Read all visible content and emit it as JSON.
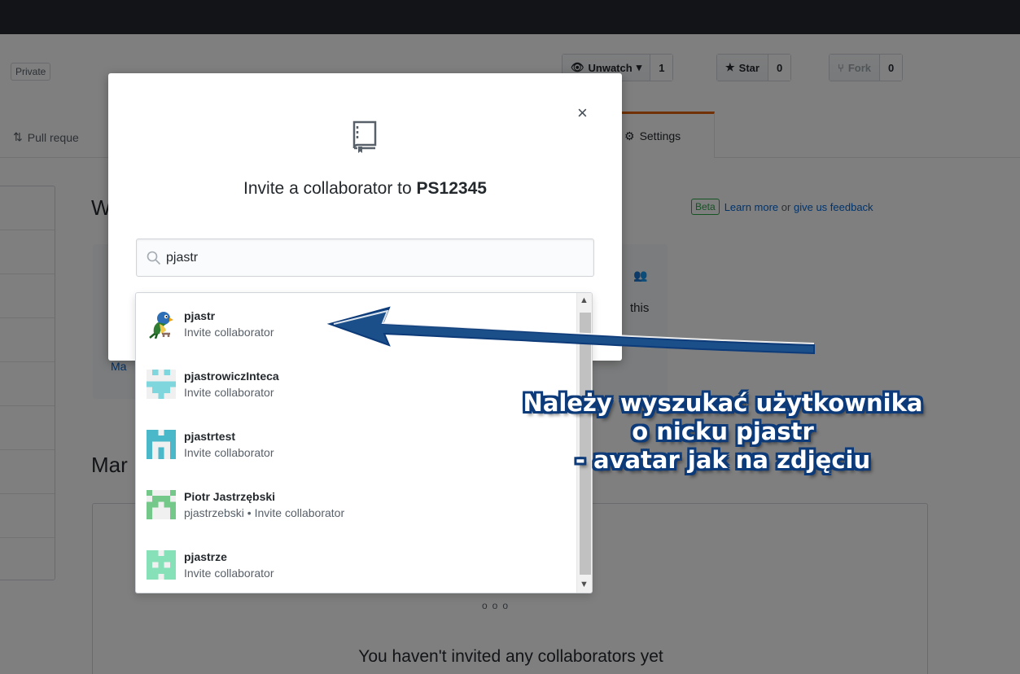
{
  "repo": {
    "private_label": "Private",
    "unwatch_label": "Unwatch",
    "unwatch_count": "1",
    "star_label": "Star",
    "star_count": "0",
    "fork_label": "Fork",
    "fork_count": "0"
  },
  "tabs": {
    "pull_requests": "Pull reque",
    "settings": "Settings"
  },
  "page": {
    "heading_w": "W",
    "heading_m": "Mar",
    "beta_tag": "Beta",
    "learn_more": "Learn more",
    "or_text": "or",
    "feedback": "give us feedback",
    "this_text": "this",
    "ma_link": "Ma",
    "no_collaborators": "You haven't invited any collaborators yet"
  },
  "modal": {
    "title_prefix": "Invite a collaborator to",
    "repo_name": "PS12345",
    "close_symbol": "×",
    "search_value": "pjastr"
  },
  "results": [
    {
      "name": "pjastr",
      "sub": "Invite collaborator"
    },
    {
      "name": "pjastrowiczInteca",
      "sub": "Invite collaborator"
    },
    {
      "name": "pjastrtest",
      "sub": "Invite collaborator"
    },
    {
      "name": "Piotr Jastrzębski",
      "sub": "pjastrzebski • Invite collaborator"
    },
    {
      "name": "pjastrze",
      "sub": "Invite collaborator"
    }
  ],
  "annotation": {
    "line1": "Należy wyszukać użytkownika",
    "line2": "o nicku pjastr",
    "line3": "- avatar jak na zdjęciu"
  },
  "colors": {
    "header_bg": "#24292e",
    "settings_tab_accent": "#e36209",
    "link": "#0366d6",
    "beta": "#28a745",
    "annotation_stroke": "#0d3a78",
    "arrow": "#1b4f8a"
  }
}
